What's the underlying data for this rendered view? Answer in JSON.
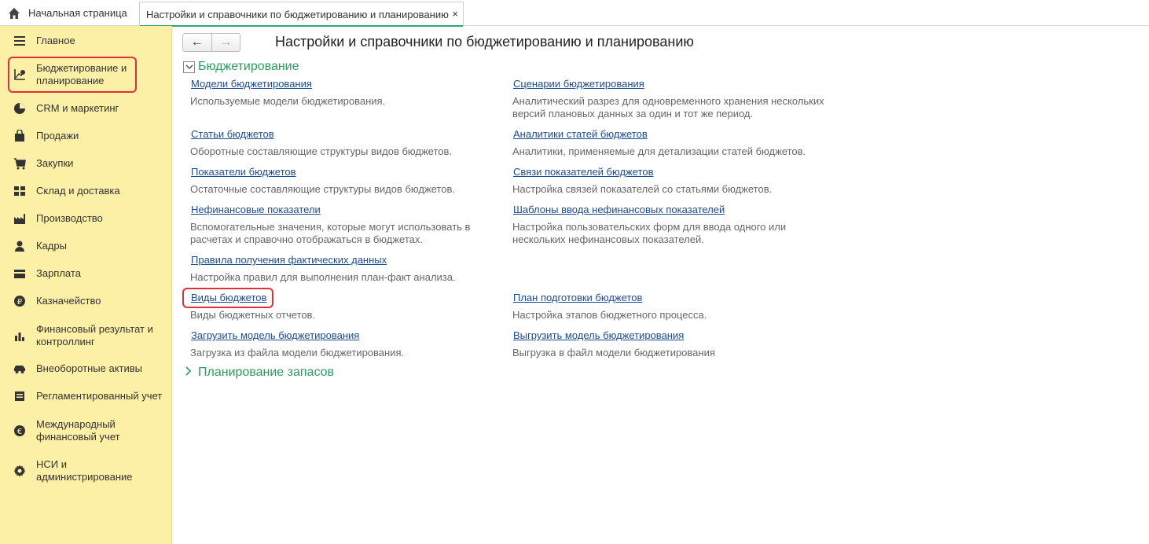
{
  "tabs": {
    "home_label": "Начальная страница",
    "active_label": "Настройки и справочники по бюджетированию и планированию",
    "close_glyph": "×"
  },
  "sidebar": {
    "items": [
      {
        "label": "Главное",
        "icon": "menu-icon"
      },
      {
        "label": "Бюджетирование и\nпланирование",
        "icon": "budget-icon"
      },
      {
        "label": "CRM и маркетинг",
        "icon": "pie-icon"
      },
      {
        "label": "Продажи",
        "icon": "bag-icon"
      },
      {
        "label": "Закупки",
        "icon": "cart-icon"
      },
      {
        "label": "Склад и доставка",
        "icon": "warehouse-icon"
      },
      {
        "label": "Производство",
        "icon": "factory-icon"
      },
      {
        "label": "Кадры",
        "icon": "person-icon"
      },
      {
        "label": "Зарплата",
        "icon": "wallet-icon"
      },
      {
        "label": "Казначейство",
        "icon": "ruble-icon"
      },
      {
        "label": "Финансовый результат и\nконтроллинг",
        "icon": "barchart-icon"
      },
      {
        "label": "Внеоборотные активы",
        "icon": "car-icon"
      },
      {
        "label": "Регламентированный учет",
        "icon": "book-icon"
      },
      {
        "label": "Международный\nфинансовый учет",
        "icon": "euro-icon"
      },
      {
        "label": "НСИ и\nадминистрирование",
        "icon": "gear-icon"
      }
    ]
  },
  "main": {
    "title": "Настройки и справочники по бюджетированию и планированию",
    "nav_back": "←",
    "nav_forward": "→",
    "group1": "Бюджетирование",
    "group2": "Планирование запасов",
    "left": [
      {
        "link": "Модели бюджетирования",
        "desc": "Используемые модели бюджетирования."
      },
      {
        "link": "Статьи бюджетов",
        "desc": "Оборотные составляющие структуры видов бюджетов."
      },
      {
        "link": "Показатели бюджетов",
        "desc": "Остаточные составляющие структуры видов бюджетов."
      },
      {
        "link": "Нефинансовые показатели",
        "desc": "Вспомогательные значения, которые могут использовать в\nрасчетах и справочно отображаться в бюджетах."
      },
      {
        "link": "Правила получения фактических данных",
        "desc": "Настройка правил для выполнения план-факт анализа."
      },
      {
        "link": "Виды бюджетов",
        "desc": "Виды бюджетных отчетов."
      },
      {
        "link": "Загрузить модель бюджетирования",
        "desc": "Загрузка из файла модели бюджетирования."
      }
    ],
    "right": [
      {
        "link": "Сценарии бюджетирования",
        "desc": "Аналитический разрез для одновременного хранения нескольких\nверсий плановых данных за один и тот же период."
      },
      {
        "link": "Аналитики статей бюджетов",
        "desc": "Аналитики, применяемые для детализации статей бюджетов."
      },
      {
        "link": "Связи показателей бюджетов",
        "desc": "Настройка связей показателей со статьями бюджетов."
      },
      {
        "link": "Шаблоны ввода нефинансовых показателей",
        "desc": "Настройка пользовательских форм для ввода одного или\nнескольких нефинансовых показателей."
      },
      {
        "link": "План подготовки бюджетов",
        "desc": "Настройка этапов бюджетного процесса."
      },
      {
        "link": "Выгрузить модель бюджетирования",
        "desc": "Выгрузка в файл модели бюджетирования"
      }
    ]
  }
}
